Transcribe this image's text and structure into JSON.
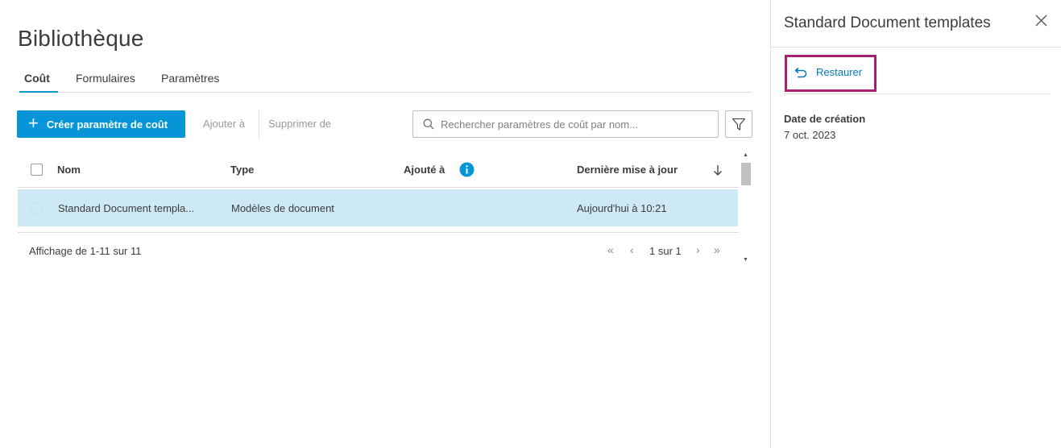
{
  "page": {
    "title": "Bibliothèque"
  },
  "tabs": [
    {
      "label": "Coût",
      "active": true
    },
    {
      "label": "Formulaires",
      "active": false
    },
    {
      "label": "Paramètres",
      "active": false
    }
  ],
  "toolbar": {
    "create_label": "Créer paramètre de coût",
    "add_to_label": "Ajouter à",
    "delete_from_label": "Supprimer de",
    "search_placeholder": "Rechercher paramètres de coût par nom..."
  },
  "table": {
    "columns": [
      "Nom",
      "Type",
      "Ajouté à",
      "Dernière mise à jour"
    ],
    "rows": [
      {
        "name": "Standard Document templa...",
        "type": "Modèles de document",
        "added_to": "",
        "updated": "Aujourd'hui à 10:21",
        "selected": true
      }
    ],
    "showing": "Affichage de 1-11 sur 11",
    "pagination": "1 sur 1"
  },
  "panel": {
    "title": "Standard Document templates",
    "restore_label": "Restaurer",
    "created_label": "Date de création",
    "created_value": "7 oct. 2023"
  },
  "colors": {
    "accent": "#0696d7",
    "selected_row": "#cde9f5",
    "highlight_box": "#a8206e",
    "link": "#0677b8"
  },
  "icons": [
    "plus-icon",
    "search-icon",
    "filter-icon",
    "info-icon",
    "sort-down-icon",
    "first-page-icon",
    "prev-page-icon",
    "next-page-icon",
    "last-page-icon",
    "close-icon",
    "restore-icon"
  ]
}
